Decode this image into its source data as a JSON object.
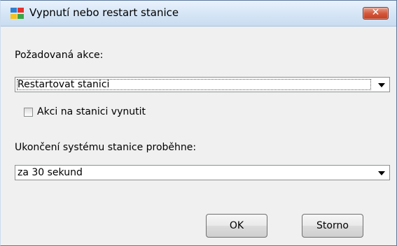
{
  "window": {
    "title": "Vypnutí nebo restart stanice",
    "close_label": "✕"
  },
  "form": {
    "action_label": "Požadovaná akce:",
    "action_value": "Restartovat stanici",
    "force_checkbox_label": "Akci na stanici vynutit",
    "force_checked": false,
    "shutdown_label": "Ukončení systému stanice proběhne:",
    "shutdown_value": "za 30 sekund"
  },
  "buttons": {
    "ok": "OK",
    "cancel": "Storno"
  },
  "colors": {
    "titlebar": "#d8e7f7",
    "close_button": "#c94a2e",
    "dialog_bg": "#f0f0f0"
  },
  "icons": {
    "app": "avg-logo-icon",
    "close": "close-icon",
    "dropdown": "chevron-down-icon"
  }
}
